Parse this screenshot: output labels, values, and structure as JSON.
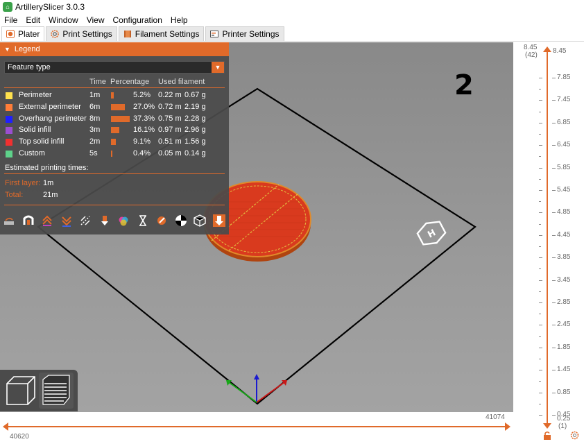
{
  "window": {
    "title": "ArtillerySlicer 3.0.3"
  },
  "menu": [
    "File",
    "Edit",
    "Window",
    "View",
    "Configuration",
    "Help"
  ],
  "tabs": [
    {
      "label": "Plater",
      "icon": "plater-icon",
      "active": true
    },
    {
      "label": "Print Settings",
      "icon": "gear-icon",
      "active": false
    },
    {
      "label": "Filament Settings",
      "icon": "filament-spool-icon",
      "active": false
    },
    {
      "label": "Printer Settings",
      "icon": "printer-icon",
      "active": false
    }
  ],
  "legend": {
    "header": "Legend",
    "view_type": "Feature type",
    "columns": {
      "time": "Time",
      "percentage": "Percentage",
      "used_filament": "Used filament"
    },
    "features": [
      {
        "name": "Perimeter",
        "color": "#ffe14d",
        "time": "1m",
        "percent": "5.2%",
        "percent_value": 5.2,
        "length": "0.22 m",
        "weight": "0.67 g"
      },
      {
        "name": "External perimeter",
        "color": "#ff7d38",
        "time": "6m",
        "percent": "27.0%",
        "percent_value": 27.0,
        "length": "0.72 m",
        "weight": "2.19 g"
      },
      {
        "name": "Overhang perimeter",
        "color": "#1f1fff",
        "time": "8m",
        "percent": "37.3%",
        "percent_value": 37.3,
        "length": "0.75 m",
        "weight": "2.28 g"
      },
      {
        "name": "Solid infill",
        "color": "#9a4ed1",
        "time": "3m",
        "percent": "16.1%",
        "percent_value": 16.1,
        "length": "0.97 m",
        "weight": "2.96 g"
      },
      {
        "name": "Top solid infill",
        "color": "#f03030",
        "time": "2m",
        "percent": "9.1%",
        "percent_value": 9.1,
        "length": "0.51 m",
        "weight": "1.56 g"
      },
      {
        "name": "Custom",
        "color": "#5ed28a",
        "time": "5s",
        "percent": "0.4%",
        "percent_value": 0.4,
        "length": "0.05 m",
        "weight": "0.14 g"
      }
    ],
    "estimated_label": "Estimated printing times:",
    "first_layer_label": "First layer:",
    "first_layer_value": "1m",
    "total_label": "Total:",
    "total_value": "21m"
  },
  "toolbar_icons": [
    "travel-icon",
    "wipe-icon",
    "retractions-icon",
    "deretractions-icon",
    "seams-icon",
    "tool-changes-icon",
    "color-changes-icon",
    "pause-prints-icon",
    "custom-gcode-icon",
    "center-of-gravity-icon",
    "shells-icon",
    "tool-marker-icon"
  ],
  "layer_number": "2",
  "view_modes": [
    "3d-view-icon",
    "layers-view-icon"
  ],
  "vertical_slider": {
    "top_value": "8.45",
    "top_layer": "(42)",
    "top_right_value": "8.45",
    "bottom_value": "0.25",
    "bottom_layer": "(1)",
    "marks": [
      "7.85",
      "7.45",
      "6.85",
      "6.45",
      "5.85",
      "5.45",
      "4.85",
      "4.45",
      "3.85",
      "3.45",
      "2.85",
      "2.45",
      "1.85",
      "1.45",
      "0.85",
      "0.45"
    ]
  },
  "horizontal_slider": {
    "left_value": "40620",
    "right_value": "41074"
  },
  "colors": {
    "accent": "#e06a2a",
    "viewport": "#999999"
  }
}
